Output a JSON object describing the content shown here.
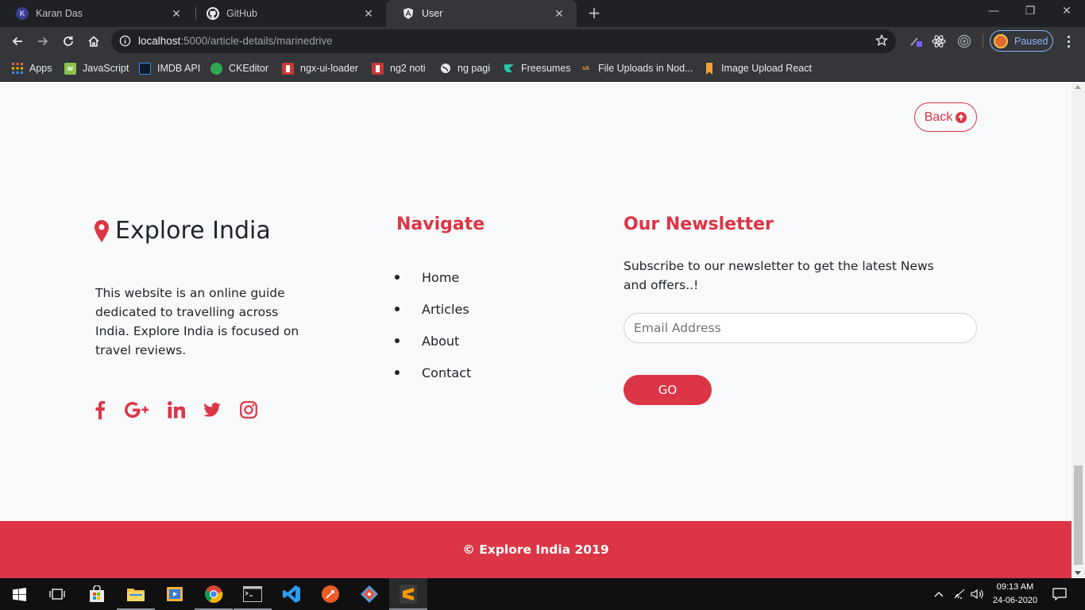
{
  "browser": {
    "tabs": [
      {
        "title": "Karan Das",
        "favicon": "k-avatar-icon",
        "active": false
      },
      {
        "title": "GitHub",
        "favicon": "github-icon",
        "active": false
      },
      {
        "title": "User",
        "favicon": "angular-icon",
        "active": true
      }
    ],
    "address": {
      "host": "localhost",
      "path": ":5000/article-details/marinedrive"
    },
    "profile_status": "Paused",
    "bookmarks": [
      {
        "label": "Apps",
        "icon": "apps-grid-icon"
      },
      {
        "label": "JavaScript",
        "icon": "javascript-bookmark-icon"
      },
      {
        "label": "IMDB API",
        "icon": "imdb-bookmark-icon"
      },
      {
        "label": "CKEditor",
        "icon": "ckeditor-bookmark-icon"
      },
      {
        "label": "ngx-ui-loader",
        "icon": "npm-bookmark-icon"
      },
      {
        "label": "ng2 noti",
        "icon": "npm-bookmark-icon"
      },
      {
        "label": "ng pagi",
        "icon": "globe-bookmark-icon"
      },
      {
        "label": "Freesumes",
        "icon": "freesumes-bookmark-icon"
      },
      {
        "label": "File Uploads in Nod...",
        "icon": "sa-bookmark-icon"
      },
      {
        "label": "Image Upload React",
        "icon": "bookmark-ribbon-icon"
      }
    ]
  },
  "page": {
    "back_label": "Back",
    "brand": "Explore India",
    "about_text": "This website is an online guide dedicated to travelling across India. Explore India is focused on travel reviews.",
    "social_icons": [
      "facebook-icon",
      "google-plus-icon",
      "linkedin-icon",
      "twitter-icon",
      "instagram-icon"
    ],
    "navigate": {
      "title": "Navigate",
      "items": [
        "Home",
        "Articles",
        "About",
        "Contact"
      ]
    },
    "newsletter": {
      "title": "Our Newsletter",
      "text": "Subscribe to our newsletter to get the latest News and offers..!",
      "placeholder": "Email Address",
      "button_label": "GO"
    },
    "copyright": "© Explore India 2019"
  },
  "taskbar": {
    "time": "09:13 AM",
    "date": "24-06-2020"
  },
  "colors": {
    "accent": "#dc3545",
    "page_bg": "#f8f9fa",
    "text": "#212529",
    "chrome_dark": "#202124",
    "chrome_toolbar": "#35363a"
  }
}
